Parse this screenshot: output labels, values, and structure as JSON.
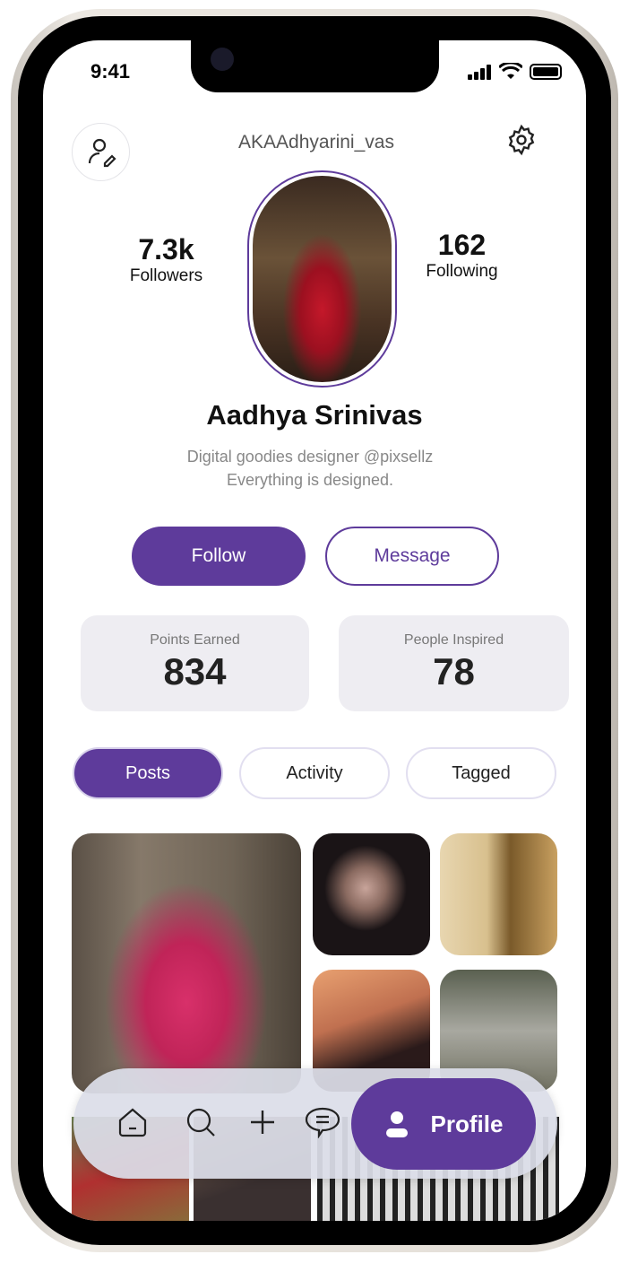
{
  "status": {
    "time": "9:41"
  },
  "header": {
    "username": "AKAAdhyarini_vas"
  },
  "profile": {
    "name": "Aadhya Srinivas",
    "bio_line1": "Digital goodies designer @pixsellz",
    "bio_line2": "Everything is designed.",
    "followers_count": "7.3k",
    "followers_label": "Followers",
    "following_count": "162",
    "following_label": "Following"
  },
  "actions": {
    "follow": "Follow",
    "message": "Message"
  },
  "stats": [
    {
      "label": "Points Earned",
      "value": "834"
    },
    {
      "label": "People Inspired",
      "value": "78"
    }
  ],
  "tabs": [
    {
      "label": "Posts",
      "active": true
    },
    {
      "label": "Activity"
    },
    {
      "label": "Tagged"
    }
  ],
  "nav": {
    "active_label": "Profile",
    "items": [
      "home-icon",
      "search-icon",
      "plus-icon",
      "chat-icon",
      "profile-icon"
    ]
  },
  "colors": {
    "accent": "#5e3b9b",
    "stat_bg": "#eeedf2"
  }
}
